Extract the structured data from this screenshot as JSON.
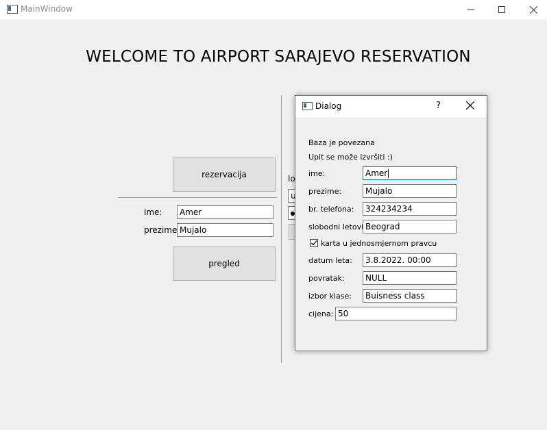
{
  "window": {
    "title": "MainWindow"
  },
  "main": {
    "heading": "WELCOME TO AIRPORT SARAJEVO RESERVATION",
    "reserve_button": "rezervacija",
    "ime_label": "ime:",
    "ime_value": "Amer",
    "prezime_label": "prezime:",
    "prezime_value": "Mujalo",
    "review_button": "pregled",
    "partial_label": "lo",
    "partial_field": "u"
  },
  "dialog": {
    "title": "Dialog",
    "help": "?",
    "status1": "Baza je povezana",
    "status2": "Upit se može izvršiti :)",
    "fields": {
      "ime": {
        "label": "ime:",
        "value": "Amer"
      },
      "prezime": {
        "label": "prezime:",
        "value": "Mujalo"
      },
      "telefon": {
        "label": "br. telefona:",
        "value": "324234234"
      },
      "letovi": {
        "label": "slobodni letovi:",
        "value": "Beograd"
      },
      "datum": {
        "label": "datum leta:",
        "value": "3.8.2022. 00:00"
      },
      "povratak": {
        "label": "povratak:",
        "value": "NULL"
      },
      "klasa": {
        "label": "izbor klase:",
        "value": "Buisness class"
      },
      "cijena": {
        "label": "cijena:",
        "value": "50"
      }
    },
    "one_way": {
      "label": "karta u jednosmjernom pravcu",
      "checked": true
    }
  }
}
